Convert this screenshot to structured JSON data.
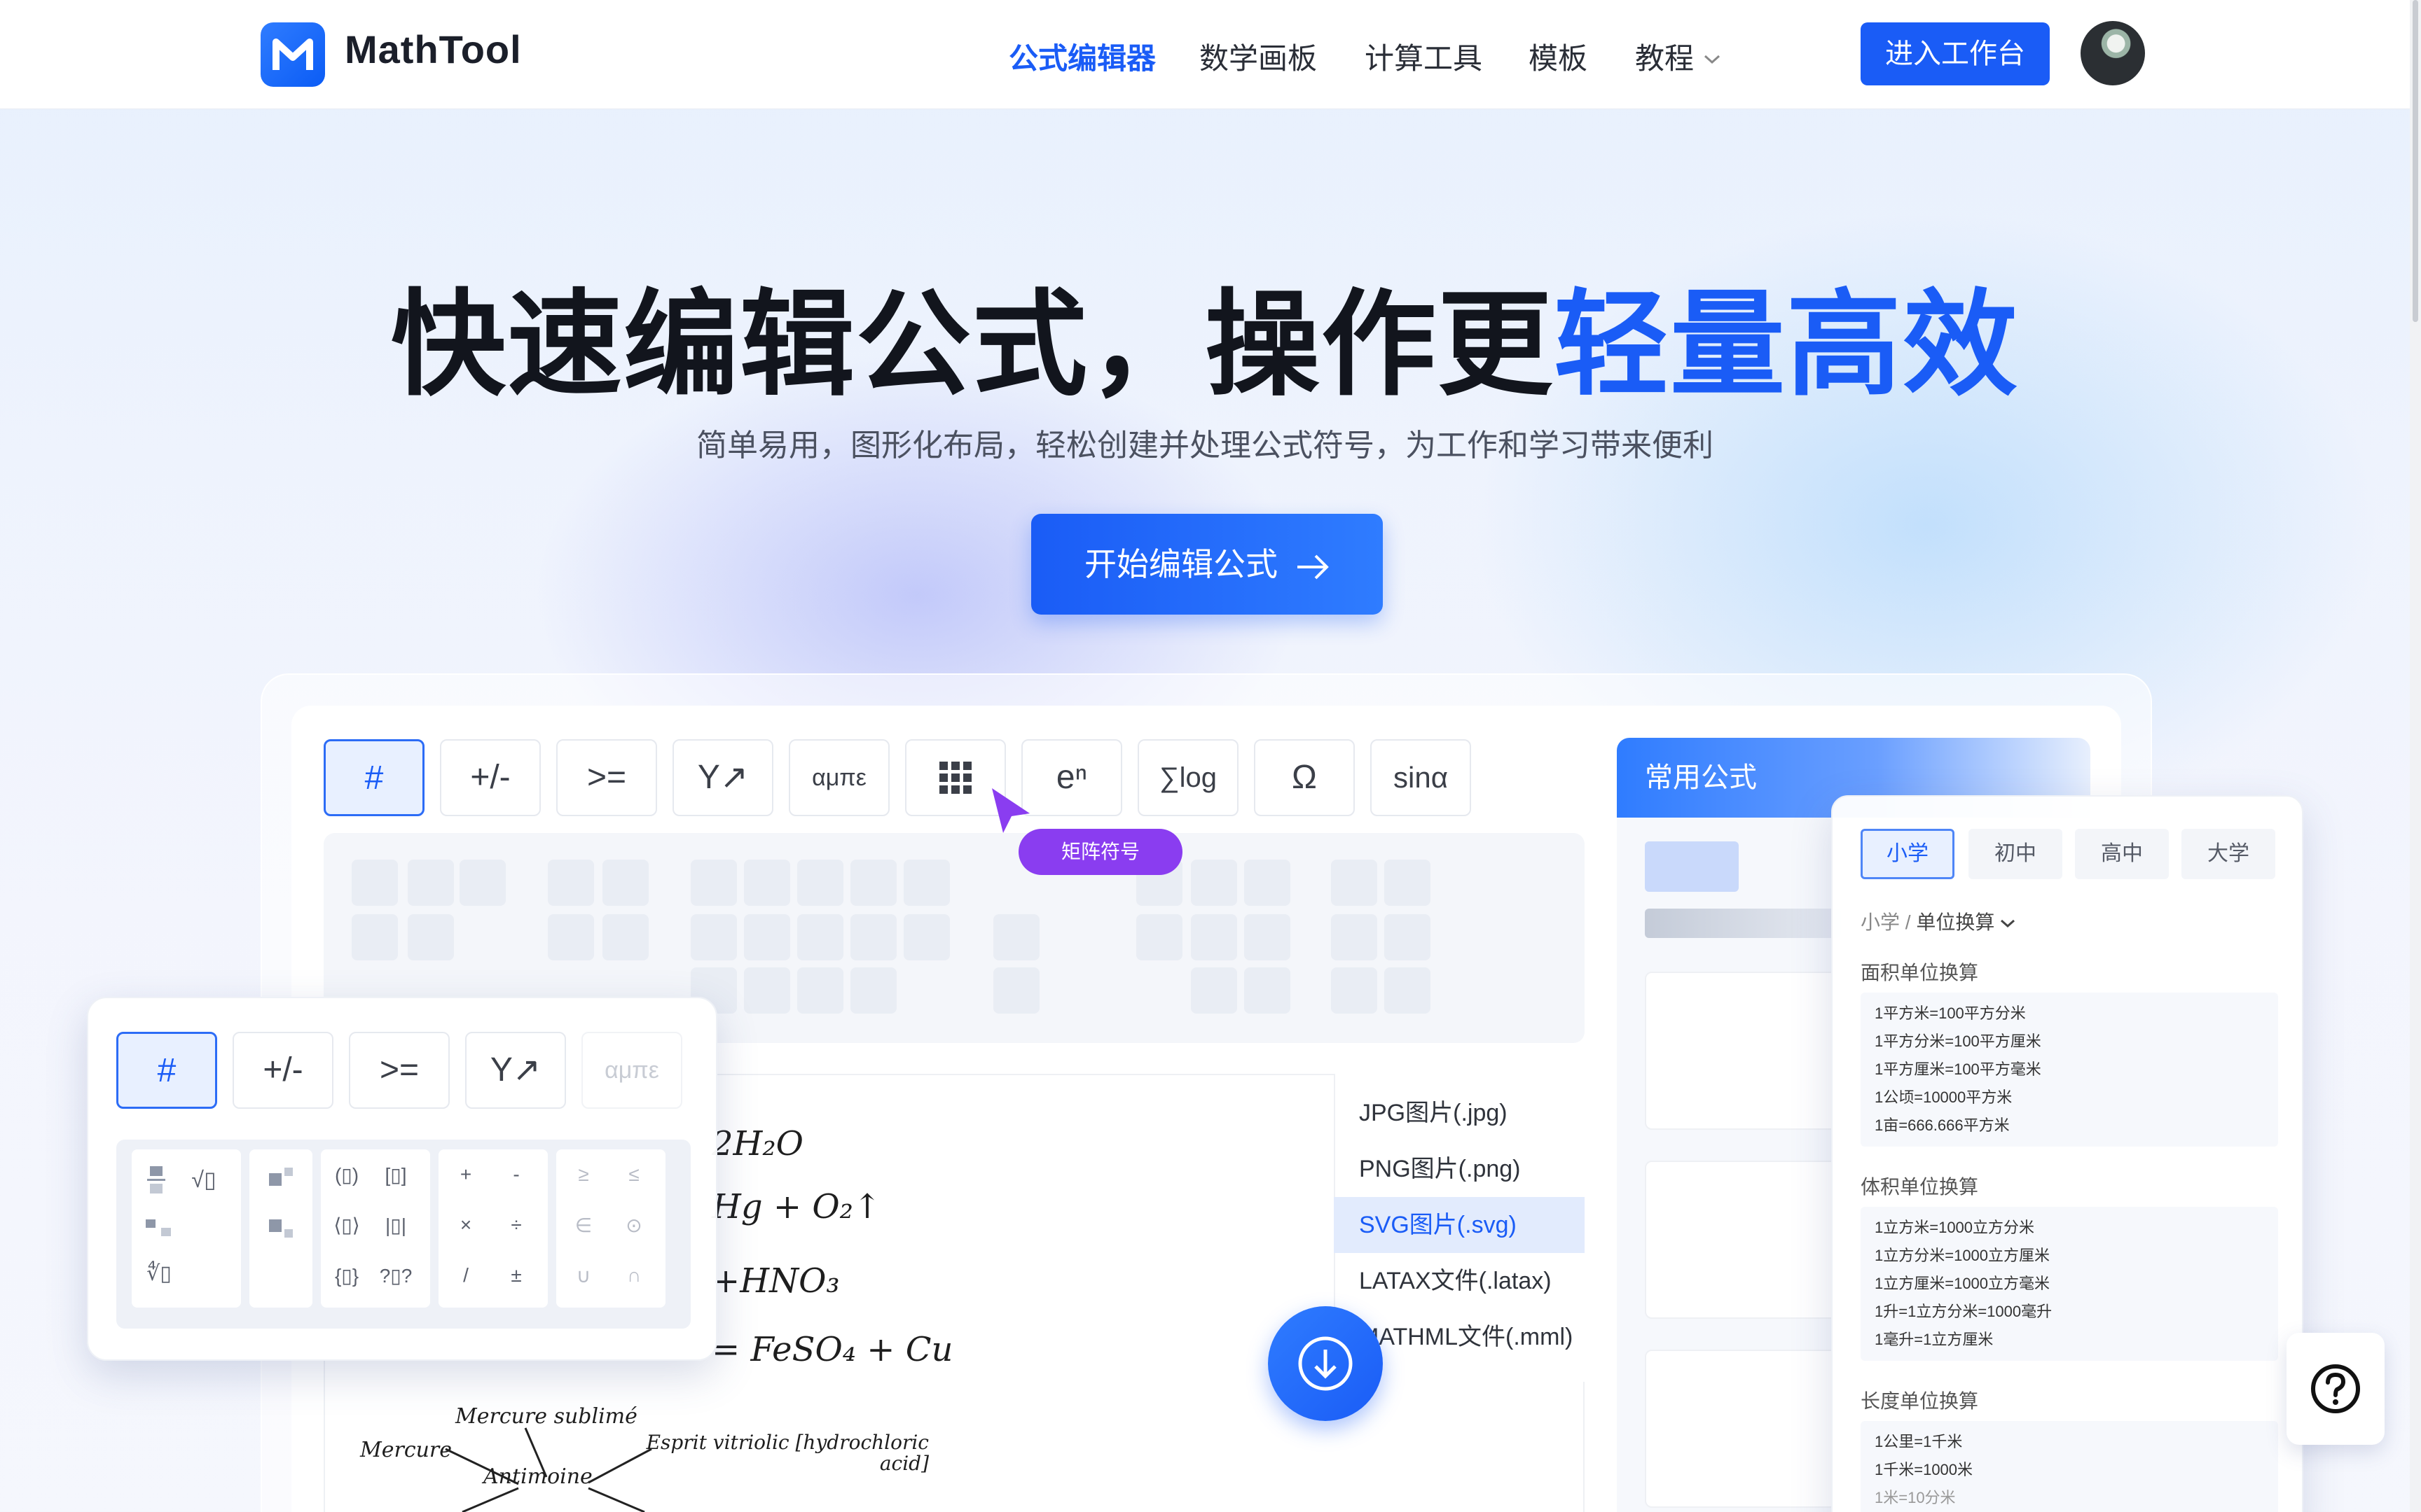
{
  "header": {
    "brand": "MathTool",
    "nav": [
      "公式编辑器",
      "数学画板",
      "计算工具",
      "模板",
      "教程"
    ],
    "enter_button": "进入工作台"
  },
  "hero": {
    "title_main": "快速编辑公式，操作更",
    "title_highlight": "轻量高效",
    "subtitle": "简单易用，图形化布局，轻松创建并处理公式符号，为工作和学习带来便利",
    "cta": "开始编辑公式"
  },
  "toolbar": {
    "tools": [
      "#",
      "+/-",
      ">=",
      "Y↗",
      "αμπε",
      "grid",
      "eⁿ",
      "∑log",
      "Ω",
      "sinα"
    ],
    "tooltip": "矩阵符号"
  },
  "editor": {
    "lines": [
      "2H₂O",
      "Hg + O₂↑",
      "+HNO₃",
      "= FeSO₄ + Cu"
    ],
    "diagram": [
      "Mercure sublimé",
      "Mercure",
      "Esprit vitriolic [hydrochloric acid]",
      "Antimoine"
    ]
  },
  "export_menu": [
    "JPG图片(.jpg)",
    "PNG图片(.png)",
    "SVG图片(.svg)",
    "LATAX文件(.latax)",
    "MATHML文件(.mml)"
  ],
  "formula_panel": {
    "title": "常用公式"
  },
  "unit_card": {
    "tabs": [
      "小学",
      "初中",
      "高中",
      "大学"
    ],
    "breadcrumb_root": "小学 /",
    "breadcrumb_current": "单位换算",
    "sections": [
      {
        "title": "面积单位换算",
        "lines": [
          "1平方米=100平方分米",
          "1平方分米=100平方厘米",
          "1平方厘米=100平方毫米",
          "1公顷=10000平方米",
          "1亩=666.666平方米"
        ]
      },
      {
        "title": "体积单位换算",
        "lines": [
          "1立方米=1000立方分米",
          "1立方分米=1000立方厘米",
          "1立方厘米=1000立方毫米",
          "1升=1立方分米=1000毫升",
          "1毫升=1立方厘米"
        ]
      },
      {
        "title": "长度单位换算",
        "lines": [
          "1公里=1千米",
          "1千米=1000米",
          "1米=10分米"
        ]
      }
    ]
  },
  "float_toolbar": {
    "tools": [
      "#",
      "+/-",
      ">=",
      "Y↗",
      "αμπε"
    ],
    "ops": [
      "+",
      "-",
      "×",
      "÷",
      "/",
      "±"
    ],
    "rel": [
      "≥",
      "≤",
      "∈",
      "⊙",
      "∪",
      "∩"
    ]
  },
  "colors": {
    "accent": "#1a5cf6",
    "tooltip": "#8a3df0"
  }
}
